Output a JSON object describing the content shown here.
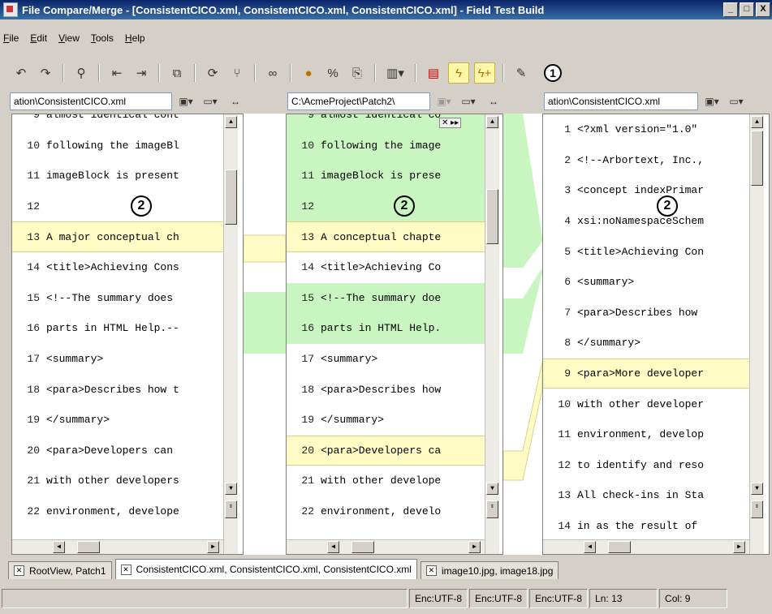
{
  "window": {
    "title": "File Compare/Merge - [ConsistentCICO.xml, ConsistentCICO.xml, ConsistentCICO.xml] - Field Test Build",
    "controls": [
      "_",
      "□",
      "X"
    ]
  },
  "menu": [
    "File",
    "Edit",
    "View",
    "Tools",
    "Help"
  ],
  "toolbar": {
    "icons": [
      "undo-icon",
      "redo-icon",
      "find-icon",
      "previous-diff-icon",
      "next-diff-icon",
      "copy-icon",
      "refresh-icon",
      "merge-icon",
      "link-icon",
      "colors-icon",
      "percent-icon",
      "copy-selection-icon",
      "columns-icon",
      "options-icon",
      "highlight-icon",
      "merge-all-icon",
      "edit-icon"
    ],
    "callout": "1"
  },
  "panes": [
    {
      "path": "ation\\ConsistentCICO.xml",
      "badge": "2",
      "lines": [
        {
          "n": "9",
          "t": "almost identical cont",
          "hl": ""
        },
        {
          "n": "10",
          "t": "following the imageBl",
          "hl": ""
        },
        {
          "n": "11",
          "t": "imageBlock is present",
          "hl": ""
        },
        {
          "n": "12",
          "t": "",
          "hl": ""
        },
        {
          "n": "13",
          "t": "A major conceptual ch",
          "hl": "yellow"
        },
        {
          "n": "14",
          "t": "<title>Achieving Cons",
          "hl": ""
        },
        {
          "n": "15",
          "t": "<!--The summary does",
          "hl": ""
        },
        {
          "n": "16",
          "t": "parts in HTML Help.--",
          "hl": ""
        },
        {
          "n": "17",
          "t": "<summary>",
          "hl": ""
        },
        {
          "n": "18",
          "t": "<para>Describes how t",
          "hl": ""
        },
        {
          "n": "19",
          "t": "</summary>",
          "hl": ""
        },
        {
          "n": "20",
          "t": "<para>Developers can",
          "hl": ""
        },
        {
          "n": "21",
          "t": "with other developers",
          "hl": ""
        },
        {
          "n": "22",
          "t": "environment, develope",
          "hl": ""
        }
      ]
    },
    {
      "path": "C:\\AcmeProject\\Patch2\\",
      "badge": "2",
      "lines": [
        {
          "n": "9",
          "t": "almost identical co",
          "hl": "green"
        },
        {
          "n": "10",
          "t": "following the image",
          "hl": "green"
        },
        {
          "n": "11",
          "t": "imageBlock is prese",
          "hl": "green"
        },
        {
          "n": "12",
          "t": "",
          "hl": "green"
        },
        {
          "n": "13",
          "t": "A conceptual chapte",
          "hl": "yellow"
        },
        {
          "n": "14",
          "t": "<title>Achieving Co",
          "hl": ""
        },
        {
          "n": "15",
          "t": "<!--The summary doe",
          "hl": "green"
        },
        {
          "n": "16",
          "t": "parts in HTML Help.",
          "hl": "green"
        },
        {
          "n": "17",
          "t": "<summary>",
          "hl": ""
        },
        {
          "n": "18",
          "t": "<para>Describes how",
          "hl": ""
        },
        {
          "n": "19",
          "t": "</summary>",
          "hl": ""
        },
        {
          "n": "20",
          "t": "<para>Developers ca",
          "hl": "yellow"
        },
        {
          "n": "21",
          "t": "with other develope",
          "hl": ""
        },
        {
          "n": "22",
          "t": "environment, develo",
          "hl": ""
        }
      ]
    },
    {
      "path": "ation\\ConsistentCICO.xml",
      "badge": "2",
      "lines": [
        {
          "n": "1",
          "t": "<?xml version=\"1.0\"",
          "hl": ""
        },
        {
          "n": "2",
          "t": "<!--Arbortext, Inc.,",
          "hl": ""
        },
        {
          "n": "3",
          "t": "<concept indexPrimar",
          "hl": ""
        },
        {
          "n": "4",
          "t": "xsi:noNamespaceSchem",
          "hl": ""
        },
        {
          "n": "5",
          "t": "<title>Achieving Con",
          "hl": ""
        },
        {
          "n": "6",
          "t": "<summary>",
          "hl": ""
        },
        {
          "n": "7",
          "t": "<para>Describes how",
          "hl": ""
        },
        {
          "n": "8",
          "t": "</summary>",
          "hl": ""
        },
        {
          "n": "9",
          "t": "<para>More developer",
          "hl": "yellow"
        },
        {
          "n": "10",
          "t": "with other developer",
          "hl": ""
        },
        {
          "n": "11",
          "t": "environment, develop",
          "hl": ""
        },
        {
          "n": "12",
          "t": "to identify and reso",
          "hl": ""
        },
        {
          "n": "13",
          "t": "All check-ins in Sta",
          "hl": ""
        },
        {
          "n": "14",
          "t": "in as the result of",
          "hl": ""
        }
      ]
    }
  ],
  "doc_tabs": [
    {
      "label": "RootView, Patch1",
      "active": false
    },
    {
      "label": "ConsistentCICO.xml, ConsistentCICO.xml, ConsistentCICO.xml",
      "active": true
    },
    {
      "label": "image10.jpg, image18.jpg",
      "active": false
    }
  ],
  "status": [
    "Enc:UTF-8",
    "Enc:UTF-8",
    "Enc:UTF-8",
    "Ln: 13",
    "Col: 9"
  ],
  "colors": {
    "diff_yellow": "#fefcc4",
    "diff_green": "#c8f5c0",
    "title_bar": "#0a246a"
  }
}
